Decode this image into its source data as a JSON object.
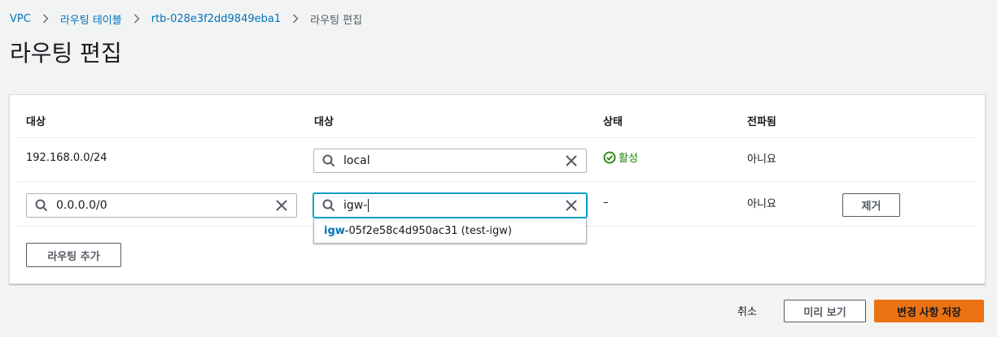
{
  "breadcrumb": {
    "items": [
      "VPC",
      "라우팅 테이블",
      "rtb-028e3f2dd9849eba1"
    ],
    "current": "라우팅 편집"
  },
  "page_title": "라우팅 편집",
  "table": {
    "headers": [
      "대상",
      "대상",
      "상태",
      "전파됨"
    ],
    "rows": [
      {
        "destination": "192.168.0.0/24",
        "target_value": "local",
        "status": "활성",
        "propagated": "아니요"
      },
      {
        "destination_value": "0.0.0.0/0",
        "target_value": "igw-",
        "status": "–",
        "propagated": "아니요",
        "remove_label": "제거"
      }
    ],
    "suggestion": {
      "match": "igw",
      "rest": "-05f2e58c4d950ac31 (test-igw)"
    },
    "add_route_label": "라우팅 추가"
  },
  "footer": {
    "cancel_label": "취소",
    "preview_label": "미리 보기",
    "save_label": "변경 사항 저장"
  },
  "colors": {
    "link": "#0073bb",
    "success": "#1d8102",
    "primary": "#ec7211",
    "focus": "#00a1c9"
  }
}
